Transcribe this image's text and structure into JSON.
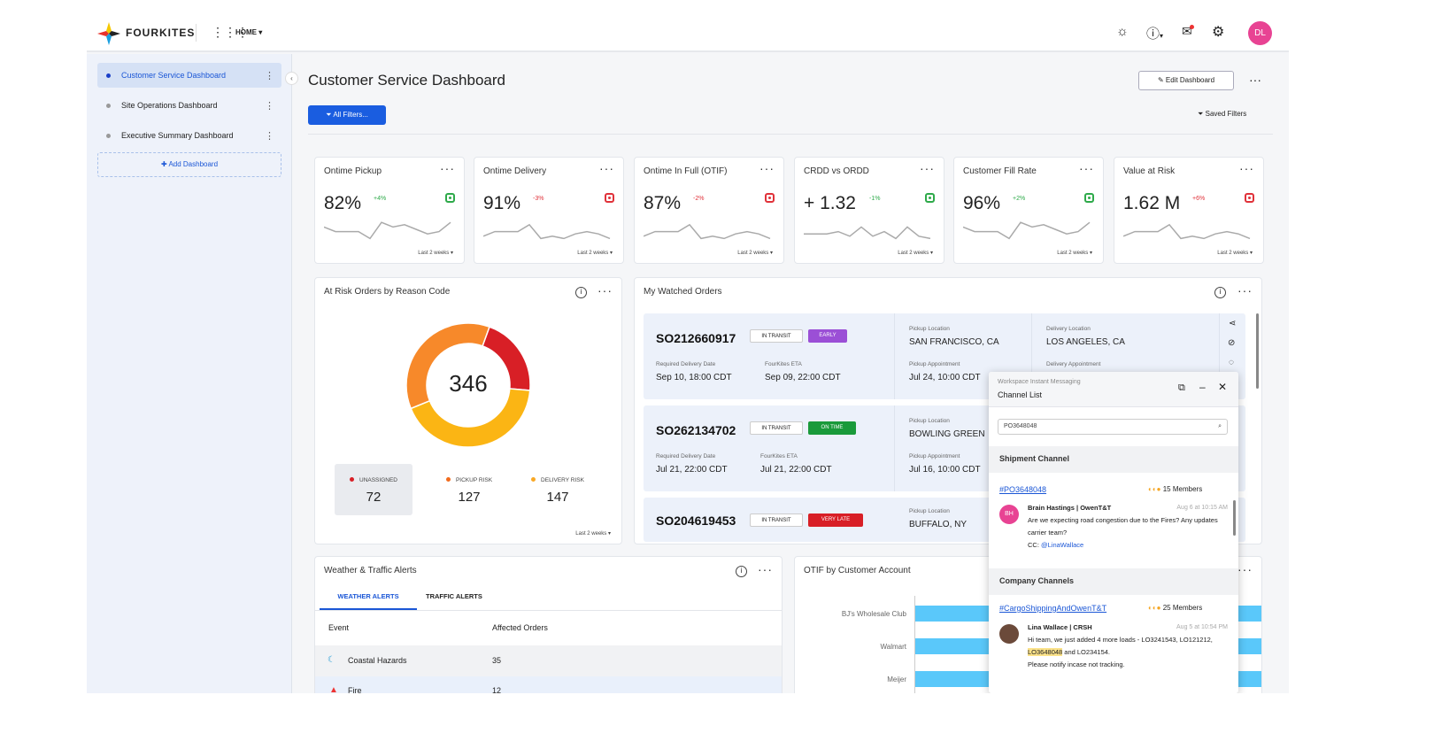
{
  "header": {
    "brand": "FOURKITES",
    "nav_label": "HOME",
    "avatar_initials": "DL",
    "icons": [
      "lightbulb-icon",
      "help-icon",
      "notifications-icon",
      "settings-icon"
    ]
  },
  "sidebar": {
    "items": [
      {
        "label": "Customer Service Dashboard",
        "active": true
      },
      {
        "label": "Site Operations Dashboard",
        "active": false
      },
      {
        "label": "Executive Summary Dashboard",
        "active": false
      }
    ],
    "add_label": "Add Dashboard"
  },
  "page": {
    "title": "Customer Service Dashboard",
    "edit_label": "Edit Dashboard",
    "filters_label": "All Filters...",
    "saved_filters_label": "Saved Filters"
  },
  "kpis": [
    {
      "title": "Ontime Pickup",
      "value": "82%",
      "delta": "+4%",
      "trend": "good",
      "footer": "Last 2 weeks",
      "spark": [
        6,
        4,
        4,
        4,
        1,
        8,
        6,
        7,
        5,
        3,
        4,
        8
      ]
    },
    {
      "title": "Ontime Delivery",
      "value": "91%",
      "delta": "-3%",
      "trend": "bad",
      "footer": "Last 2 weeks",
      "spark": [
        2,
        4,
        4,
        4,
        7,
        1,
        2,
        1,
        3,
        4,
        3,
        1
      ]
    },
    {
      "title": "Ontime In Full (OTIF)",
      "value": "87%",
      "delta": "-2%",
      "trend": "bad",
      "footer": "Last 2 weeks",
      "spark": [
        2,
        4,
        4,
        4,
        7,
        1,
        2,
        1,
        3,
        4,
        3,
        1
      ]
    },
    {
      "title": "CRDD vs ORDD",
      "value": "+ 1.32",
      "delta": "-1%",
      "trend": "good",
      "footer": "Last 2 weeks",
      "spark": [
        3,
        3,
        3,
        4,
        2,
        6,
        2,
        4,
        1,
        6,
        2,
        1
      ]
    },
    {
      "title": "Customer Fill Rate",
      "value": "96%",
      "delta": "+2%",
      "trend": "good",
      "footer": "Last 2 weeks",
      "spark": [
        6,
        4,
        4,
        4,
        1,
        8,
        6,
        7,
        5,
        3,
        4,
        8
      ]
    },
    {
      "title": "Value at Risk",
      "value": "1.62 M",
      "delta": "+6%",
      "trend": "bad",
      "footer": "Last 2 weeks",
      "spark": [
        2,
        4,
        4,
        4,
        7,
        1,
        2,
        1,
        3,
        4,
        3,
        1
      ]
    }
  ],
  "at_risk": {
    "title": "At Risk Orders by Reason Code",
    "total": "346",
    "footer": "Last 2 weeks",
    "segments": [
      {
        "label": "UNASSIGNED",
        "value": 72,
        "color": "#d81f26"
      },
      {
        "label": "DELIVERY RISK",
        "value": 147,
        "color": "#fbb514"
      },
      {
        "label": "PICKUP RISK",
        "value": 127,
        "color": "#f7892a"
      }
    ],
    "stats": [
      {
        "label": "UNASSIGNED",
        "value": "72",
        "color": "#d81f26"
      },
      {
        "label": "PICKUP RISK",
        "value": "127",
        "color": "#f26b1d"
      },
      {
        "label": "DELIVERY RISK",
        "value": "147",
        "color": "#f9a825"
      }
    ]
  },
  "watched": {
    "title": "My Watched Orders",
    "labels": {
      "req": "Required Delivery Date",
      "eta": "FourKites ETA",
      "pickup_loc": "Pickup Location",
      "pickup_appt": "Pickup Appointment",
      "delivery_loc": "Delivery Location",
      "delivery_appt": "Delivery Appointment"
    },
    "orders": [
      {
        "id": "SO212660917",
        "status": "IN TRANSIT",
        "tag": "EARLY",
        "tag_color": "#9b4fd6",
        "req": "Sep 10, 18:00 CDT",
        "eta": "Sep 09, 22:00 CDT",
        "pickup_loc": "SAN FRANCISCO, CA",
        "pickup_appt": "Jul 24, 10:00 CDT",
        "delivery_loc": "LOS ANGELES, CA"
      },
      {
        "id": "SO262134702",
        "status": "IN TRANSIT",
        "tag": "ON TIME",
        "tag_color": "#1a9a3a",
        "req": "Jul 21, 22:00 CDT",
        "eta": "Jul 21, 22:00 CDT",
        "pickup_loc": "BOWLING GREEN",
        "pickup_appt": "Jul 16, 10:00 CDT"
      },
      {
        "id": "SO204619453",
        "status": "IN TRANSIT",
        "tag": "VERY LATE",
        "tag_color": "#d81f26",
        "pickup_loc": "BUFFALO, NY"
      }
    ]
  },
  "weather": {
    "title": "Weather & Traffic Alerts",
    "tabs": [
      "WEATHER ALERTS",
      "TRAFFIC ALERTS"
    ],
    "columns": [
      "Event",
      "Affected Orders"
    ],
    "rows": [
      {
        "event": "Coastal Hazards",
        "orders": "35"
      },
      {
        "event": "Fire",
        "orders": "12"
      }
    ]
  },
  "otif": {
    "title": "OTIF by Customer Account",
    "chart_data": {
      "type": "bar",
      "orientation": "horizontal",
      "categories": [
        "BJ's Wholesale Club",
        "Walmart",
        "Meijer"
      ],
      "color": "#5ac8fa"
    }
  },
  "messaging": {
    "app": "Workspace Instant Messaging",
    "title": "Channel List",
    "search_value": "PO3648048",
    "shipment_section": "Shipment Channel",
    "shipment_channel": "#PO3648048",
    "shipment_members": "15 Members",
    "msg1": {
      "author": "Brain Hastings | OwenT&T",
      "initials": "BH",
      "time": "Aug 6 at 10:15 AM",
      "text": "Are we expecting road congestion due to the Fires? Any updates carrier team?",
      "cc": "CC:",
      "mention": "@LinaWallace"
    },
    "company_section": "Company Channels",
    "company_channel": "#CargoShippingAndOwenT&T",
    "company_members": "25 Members",
    "msg2": {
      "author": "Lina Wallace | CRSH",
      "time": "Aug 5 at 10:54 PM",
      "text_a": "Hi team, we just added 4 more loads - LO3241543, LO121212, ",
      "highlight": "LO3648048",
      "text_b": " and LO234154.",
      "text_c": "Please notify incase not tracking."
    }
  }
}
